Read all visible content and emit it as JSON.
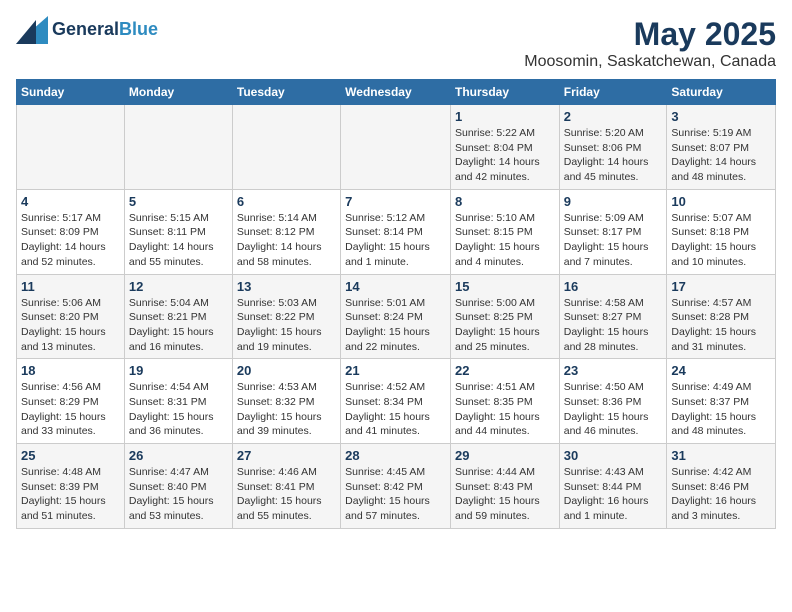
{
  "logo": {
    "line1": "General",
    "line2": "Blue"
  },
  "title": "May 2025",
  "subtitle": "Moosomin, Saskatchewan, Canada",
  "weekdays": [
    "Sunday",
    "Monday",
    "Tuesday",
    "Wednesday",
    "Thursday",
    "Friday",
    "Saturday"
  ],
  "weeks": [
    [
      {
        "day": "",
        "info": ""
      },
      {
        "day": "",
        "info": ""
      },
      {
        "day": "",
        "info": ""
      },
      {
        "day": "",
        "info": ""
      },
      {
        "day": "1",
        "info": "Sunrise: 5:22 AM\nSunset: 8:04 PM\nDaylight: 14 hours\nand 42 minutes."
      },
      {
        "day": "2",
        "info": "Sunrise: 5:20 AM\nSunset: 8:06 PM\nDaylight: 14 hours\nand 45 minutes."
      },
      {
        "day": "3",
        "info": "Sunrise: 5:19 AM\nSunset: 8:07 PM\nDaylight: 14 hours\nand 48 minutes."
      }
    ],
    [
      {
        "day": "4",
        "info": "Sunrise: 5:17 AM\nSunset: 8:09 PM\nDaylight: 14 hours\nand 52 minutes."
      },
      {
        "day": "5",
        "info": "Sunrise: 5:15 AM\nSunset: 8:11 PM\nDaylight: 14 hours\nand 55 minutes."
      },
      {
        "day": "6",
        "info": "Sunrise: 5:14 AM\nSunset: 8:12 PM\nDaylight: 14 hours\nand 58 minutes."
      },
      {
        "day": "7",
        "info": "Sunrise: 5:12 AM\nSunset: 8:14 PM\nDaylight: 15 hours\nand 1 minute."
      },
      {
        "day": "8",
        "info": "Sunrise: 5:10 AM\nSunset: 8:15 PM\nDaylight: 15 hours\nand 4 minutes."
      },
      {
        "day": "9",
        "info": "Sunrise: 5:09 AM\nSunset: 8:17 PM\nDaylight: 15 hours\nand 7 minutes."
      },
      {
        "day": "10",
        "info": "Sunrise: 5:07 AM\nSunset: 8:18 PM\nDaylight: 15 hours\nand 10 minutes."
      }
    ],
    [
      {
        "day": "11",
        "info": "Sunrise: 5:06 AM\nSunset: 8:20 PM\nDaylight: 15 hours\nand 13 minutes."
      },
      {
        "day": "12",
        "info": "Sunrise: 5:04 AM\nSunset: 8:21 PM\nDaylight: 15 hours\nand 16 minutes."
      },
      {
        "day": "13",
        "info": "Sunrise: 5:03 AM\nSunset: 8:22 PM\nDaylight: 15 hours\nand 19 minutes."
      },
      {
        "day": "14",
        "info": "Sunrise: 5:01 AM\nSunset: 8:24 PM\nDaylight: 15 hours\nand 22 minutes."
      },
      {
        "day": "15",
        "info": "Sunrise: 5:00 AM\nSunset: 8:25 PM\nDaylight: 15 hours\nand 25 minutes."
      },
      {
        "day": "16",
        "info": "Sunrise: 4:58 AM\nSunset: 8:27 PM\nDaylight: 15 hours\nand 28 minutes."
      },
      {
        "day": "17",
        "info": "Sunrise: 4:57 AM\nSunset: 8:28 PM\nDaylight: 15 hours\nand 31 minutes."
      }
    ],
    [
      {
        "day": "18",
        "info": "Sunrise: 4:56 AM\nSunset: 8:29 PM\nDaylight: 15 hours\nand 33 minutes."
      },
      {
        "day": "19",
        "info": "Sunrise: 4:54 AM\nSunset: 8:31 PM\nDaylight: 15 hours\nand 36 minutes."
      },
      {
        "day": "20",
        "info": "Sunrise: 4:53 AM\nSunset: 8:32 PM\nDaylight: 15 hours\nand 39 minutes."
      },
      {
        "day": "21",
        "info": "Sunrise: 4:52 AM\nSunset: 8:34 PM\nDaylight: 15 hours\nand 41 minutes."
      },
      {
        "day": "22",
        "info": "Sunrise: 4:51 AM\nSunset: 8:35 PM\nDaylight: 15 hours\nand 44 minutes."
      },
      {
        "day": "23",
        "info": "Sunrise: 4:50 AM\nSunset: 8:36 PM\nDaylight: 15 hours\nand 46 minutes."
      },
      {
        "day": "24",
        "info": "Sunrise: 4:49 AM\nSunset: 8:37 PM\nDaylight: 15 hours\nand 48 minutes."
      }
    ],
    [
      {
        "day": "25",
        "info": "Sunrise: 4:48 AM\nSunset: 8:39 PM\nDaylight: 15 hours\nand 51 minutes."
      },
      {
        "day": "26",
        "info": "Sunrise: 4:47 AM\nSunset: 8:40 PM\nDaylight: 15 hours\nand 53 minutes."
      },
      {
        "day": "27",
        "info": "Sunrise: 4:46 AM\nSunset: 8:41 PM\nDaylight: 15 hours\nand 55 minutes."
      },
      {
        "day": "28",
        "info": "Sunrise: 4:45 AM\nSunset: 8:42 PM\nDaylight: 15 hours\nand 57 minutes."
      },
      {
        "day": "29",
        "info": "Sunrise: 4:44 AM\nSunset: 8:43 PM\nDaylight: 15 hours\nand 59 minutes."
      },
      {
        "day": "30",
        "info": "Sunrise: 4:43 AM\nSunset: 8:44 PM\nDaylight: 16 hours\nand 1 minute."
      },
      {
        "day": "31",
        "info": "Sunrise: 4:42 AM\nSunset: 8:46 PM\nDaylight: 16 hours\nand 3 minutes."
      }
    ]
  ]
}
